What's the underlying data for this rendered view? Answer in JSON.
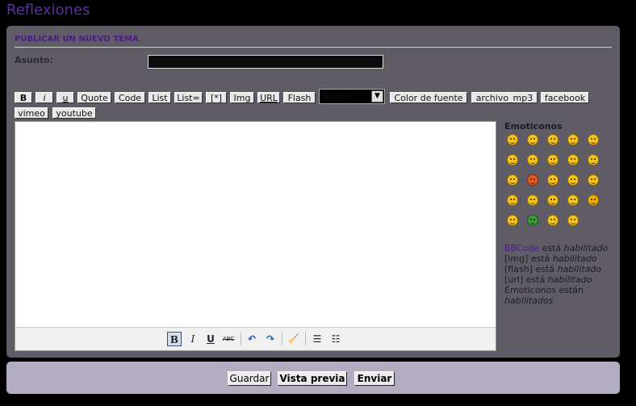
{
  "page": {
    "title": "Reflexiones"
  },
  "form": {
    "section_title": "PUBLICAR UN NUEVO TEMA",
    "subject_label": "Asunto:",
    "subject_value": ""
  },
  "toolbar": {
    "bold": "B",
    "italic": "i",
    "underline": "u",
    "quote": "Quote",
    "code": "Code",
    "list": "List",
    "list_eq": "List=",
    "list_item": "[*]",
    "img": "Img",
    "url": "URL",
    "flash": "Flash",
    "font_size_value": "Normal",
    "font_color": "Color de fuente",
    "mp3": "archivo_mp3",
    "facebook": "facebook",
    "vimeo": "vimeo",
    "youtube": "youtube"
  },
  "rte": {
    "bold": "B",
    "italic": "I",
    "underline": "U",
    "strike": "ABC",
    "undo": "↶",
    "redo": "↷",
    "clean": "🧹",
    "ul": "☰",
    "ol": "☷"
  },
  "emoticons": {
    "title": "Emoticonos"
  },
  "status": {
    "bbcode_link": "BBCode",
    "bbcode_rest": " está ",
    "bbcode_state": "habilitado",
    "img_text": "[img] está ",
    "img_state": "habilitado",
    "flash_text": "[flash] está ",
    "flash_state": "habilitado",
    "url_text": "[url] está ",
    "url_state": "habilitado",
    "emo_text": "Emoticonos están ",
    "emo_state": "habilitados"
  },
  "actions": {
    "save": "Guardar",
    "preview": "Vista previa",
    "send": "Enviar"
  }
}
